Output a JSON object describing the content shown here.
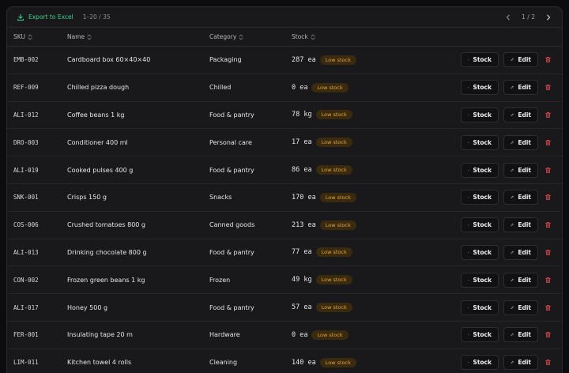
{
  "toolbar": {
    "export_label": "Export to Excel",
    "range": "1–20 / 35",
    "page": "1 / 2"
  },
  "columns": {
    "sku": "SKU",
    "name": "Name",
    "category": "Category",
    "stock": "Stock"
  },
  "actions": {
    "stock_label": "Stock",
    "edit_label": "Edit"
  },
  "colors": {
    "accent": "#3ecf8e",
    "badge_text": "#e3a337",
    "badge_bg": "#3a2a0e",
    "danger": "#e5484d"
  },
  "rows": [
    {
      "sku": "EMB-002",
      "name": "Cardboard box 60×40×40",
      "category": "Packaging",
      "qty": "287 ea",
      "badge": "Low stock"
    },
    {
      "sku": "REF-009",
      "name": "Chilled pizza dough",
      "category": "Chilled",
      "qty": "0 ea",
      "badge": "Low stock"
    },
    {
      "sku": "ALI-012",
      "name": "Coffee beans 1 kg",
      "category": "Food & pantry",
      "qty": "78 kg",
      "badge": "Low stock"
    },
    {
      "sku": "DRO-003",
      "name": "Conditioner 400 ml",
      "category": "Personal care",
      "qty": "17 ea",
      "badge": "Low stock"
    },
    {
      "sku": "ALI-019",
      "name": "Cooked pulses 400 g",
      "category": "Food & pantry",
      "qty": "86 ea",
      "badge": "Low stock"
    },
    {
      "sku": "SNK-001",
      "name": "Crisps 150 g",
      "category": "Snacks",
      "qty": "170 ea",
      "badge": "Low stock"
    },
    {
      "sku": "COS-006",
      "name": "Crushed tomatoes 800 g",
      "category": "Canned goods",
      "qty": "213 ea",
      "badge": "Low stock"
    },
    {
      "sku": "ALI-013",
      "name": "Drinking chocolate 800 g",
      "category": "Food & pantry",
      "qty": "77 ea",
      "badge": "Low stock"
    },
    {
      "sku": "CON-002",
      "name": "Frozen green beans 1 kg",
      "category": "Frozen",
      "qty": "49 kg",
      "badge": "Low stock"
    },
    {
      "sku": "ALI-017",
      "name": "Honey 500 g",
      "category": "Food & pantry",
      "qty": "57 ea",
      "badge": "Low stock"
    },
    {
      "sku": "FER-001",
      "name": "Insulating tape 20 m",
      "category": "Hardware",
      "qty": "0 ea",
      "badge": "Low stock"
    },
    {
      "sku": "LIM-011",
      "name": "Kitchen towel 4 rolls",
      "category": "Cleaning",
      "qty": "140 ea",
      "badge": "Low stock"
    }
  ]
}
